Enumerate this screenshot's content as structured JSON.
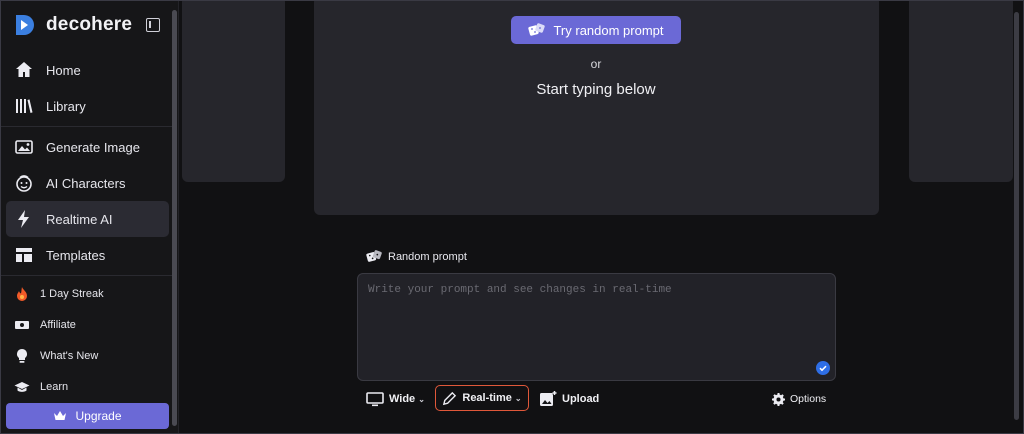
{
  "brand": {
    "name": "decohere"
  },
  "sidebar": {
    "items": [
      {
        "label": "Home",
        "icon": "home-icon"
      },
      {
        "label": "Library",
        "icon": "library-icon"
      },
      {
        "label": "Generate Image",
        "icon": "image-icon"
      },
      {
        "label": "AI Characters",
        "icon": "character-face-icon"
      },
      {
        "label": "Realtime AI",
        "icon": "lightning-icon",
        "active": true
      },
      {
        "label": "Templates",
        "icon": "template-layout-icon"
      }
    ],
    "small_items": [
      {
        "label": "1 Day Streak",
        "icon": "flame-icon"
      },
      {
        "label": "Affiliate",
        "icon": "money-icon"
      },
      {
        "label": "What's New",
        "icon": "lightbulb-icon"
      },
      {
        "label": "Learn",
        "icon": "graduation-cap-icon"
      }
    ],
    "upgrade_label": "Upgrade"
  },
  "main": {
    "try_random_label": "Try random prompt",
    "or_text": "or",
    "start_text": "Start typing below",
    "random_prompt_label": "Random prompt",
    "prompt_placeholder": "Write your prompt and see changes in real-time",
    "toolbar": {
      "wide_label": "Wide",
      "realtime_label": "Real-time",
      "upload_label": "Upload",
      "options_label": "Options"
    }
  },
  "colors": {
    "accent": "#6b69d6",
    "realtime_border": "#e0583a",
    "check": "#2e6ee6",
    "background": "#111113",
    "panel": "#26262c"
  }
}
